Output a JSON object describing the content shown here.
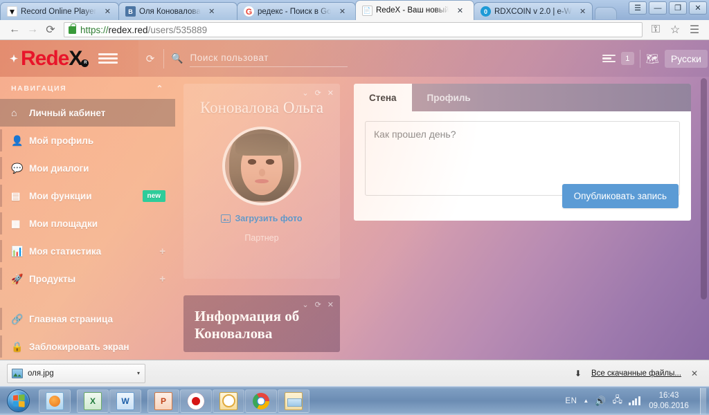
{
  "browser": {
    "tabs": [
      {
        "title": "Record Online Player",
        "favicon": "record-icon",
        "active": false
      },
      {
        "title": "Оля Коновалова",
        "favicon": "vk-icon",
        "active": false
      },
      {
        "title": "редекс - Поиск в Go",
        "favicon": "google-icon",
        "active": false
      },
      {
        "title": "RedeX - Ваш новый",
        "favicon": "document-icon",
        "active": true
      },
      {
        "title": "RDXCOIN v 2.0 | e-W",
        "favicon": "rdxcoin-icon",
        "active": false
      }
    ],
    "close_label": "✕",
    "window_buttons": {
      "user": "☰",
      "minimize": "—",
      "maximize": "❐",
      "close": "✕"
    },
    "back_label": "←",
    "forward_label": "→",
    "reload_label": "⟳",
    "url_secure": "https://",
    "url_host": "redex.red",
    "url_path": "/users/535889",
    "key_icon_label": "⚿",
    "star_icon_label": "☆",
    "menu_icon_label": "☰"
  },
  "header": {
    "logo_rede": "Rede",
    "logo_x": "X",
    "logo_reg": "reg",
    "search_placeholder": "Поиск пользоват",
    "search_value": "",
    "news_badge": "1",
    "language_label": "Русски",
    "refresh_label": "⟳"
  },
  "sidebar": {
    "heading": "НАВИГАЦИЯ",
    "collapse_label": "⌃",
    "items": [
      {
        "label": "Личный кабинет",
        "icon": "home-icon",
        "glyph": "⌂",
        "active": true,
        "badge": "",
        "plus": false
      },
      {
        "label": "Мой профиль",
        "icon": "user-icon",
        "glyph": "👤",
        "active": false,
        "badge": "",
        "plus": false
      },
      {
        "label": "Мои диалоги",
        "icon": "chat-icon",
        "glyph": "💬",
        "active": false,
        "badge": "",
        "plus": false
      },
      {
        "label": "Мои функции",
        "icon": "list-icon",
        "glyph": "▤",
        "active": false,
        "badge": "new",
        "plus": false
      },
      {
        "label": "Мои площадки",
        "icon": "grid-icon",
        "glyph": "▦",
        "active": false,
        "badge": "",
        "plus": false
      },
      {
        "label": "Моя статистика",
        "icon": "bar-chart-icon",
        "glyph": "📊",
        "active": false,
        "badge": "",
        "plus": true
      },
      {
        "label": "Продукты",
        "icon": "rocket-icon",
        "glyph": "🚀",
        "active": false,
        "badge": "",
        "plus": true
      }
    ],
    "items_bottom": [
      {
        "label": "Главная страница",
        "icon": "link-icon",
        "glyph": "🔗"
      },
      {
        "label": "Заблокировать экран",
        "icon": "lock-icon",
        "glyph": "🔒"
      }
    ]
  },
  "profile_card": {
    "name": "Коновалова Ольга",
    "upload_photo_label": "Загрузить фото",
    "role": "Партнер",
    "tools": {
      "collapse": "⌄",
      "refresh": "⟳",
      "close": "✕"
    }
  },
  "info_panel": {
    "title": "Информация об Коновалова",
    "tools": {
      "collapse": "⌄",
      "refresh": "⟳",
      "close": "✕"
    }
  },
  "wall": {
    "tabs": [
      {
        "label": "Стена",
        "active": true
      },
      {
        "label": "Профиль",
        "active": false
      }
    ],
    "textarea_placeholder": "Как прошел день?",
    "textarea_value": "",
    "publish_label": "Опубликовать запись"
  },
  "downloads": {
    "filename": "оля.jpg",
    "caret": "▾",
    "arrow": "⬇",
    "all_downloads_label": "Все скачанные файлы...",
    "close_label": "✕"
  },
  "taskbar": {
    "apps": [
      {
        "name": "windows-media-player",
        "class": "ico-wmp",
        "label": ""
      },
      {
        "name": "microsoft-excel",
        "class": "ico-xls",
        "label": "X"
      },
      {
        "name": "microsoft-word",
        "class": "ico-doc",
        "label": "W"
      },
      {
        "name": "microsoft-powerpoint",
        "class": "ico-ppt",
        "label": "P"
      },
      {
        "name": "opera-browser",
        "class": "ico-opera",
        "label": ""
      },
      {
        "name": "microsoft-outlook",
        "class": "ico-outlook",
        "label": ""
      },
      {
        "name": "google-chrome",
        "class": "ico-chrome",
        "label": ""
      },
      {
        "name": "windows-explorer",
        "class": "ico-explorer",
        "label": ""
      }
    ],
    "tray_language": "EN",
    "tray_chevron": "▲",
    "tray_volume": "🔊",
    "tray_network": "🖧",
    "clock_time": "16:43",
    "clock_date": "09.06.2016"
  },
  "colors": {
    "brand_red": "#e8152a",
    "accent_blue": "#5b9bd5",
    "badge_green": "#2ecc9a",
    "link_blue": "#3a8fd4"
  }
}
